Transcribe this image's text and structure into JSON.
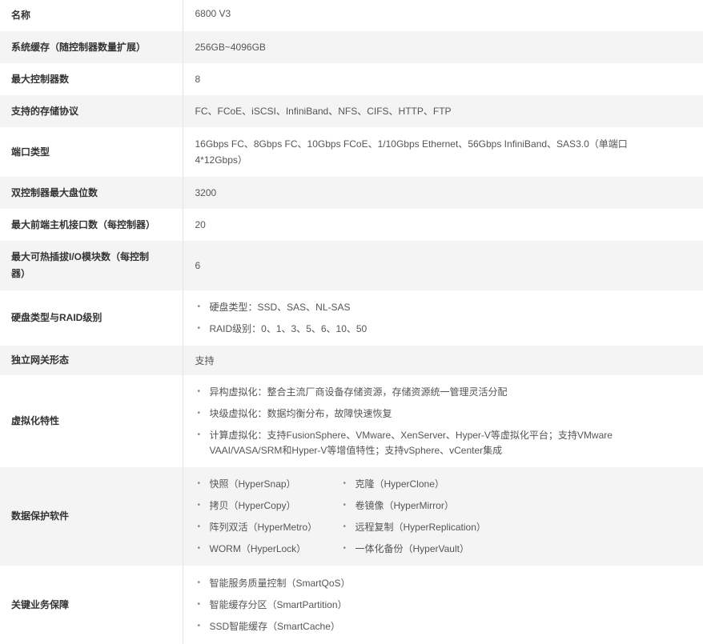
{
  "rows": [
    {
      "label": "名称",
      "value": "6800 V3"
    },
    {
      "label": "系统缓存（随控制器数量扩展）",
      "value": "256GB~4096GB"
    },
    {
      "label": "最大控制器数",
      "value": "8"
    },
    {
      "label": "支持的存储协议",
      "value": "FC、FCoE、iSCSI、InfiniBand、NFS、CIFS、HTTP、FTP"
    },
    {
      "label": "端口类型",
      "value": "16Gbps FC、8Gbps FC、10Gbps FCoE、1/10Gbps Ethernet、56Gbps InfiniBand、SAS3.0（单端口4*12Gbps）"
    },
    {
      "label": "双控制器最大盘位数",
      "value": "3200"
    },
    {
      "label": "最大前端主机接口数（每控制器）",
      "value": "20"
    },
    {
      "label": "最大可热插拔I/O模块数（每控制器）",
      "value": "6"
    },
    {
      "label": "硬盘类型与RAID级别",
      "items": [
        "硬盘类型：SSD、SAS、NL-SAS",
        "RAID级别：0、1、3、5、6、10、50"
      ]
    },
    {
      "label": "独立网关形态",
      "value": "支持"
    },
    {
      "label": "虚拟化特性",
      "items": [
        "异构虚拟化：整合主流厂商设备存储资源，存储资源统一管理灵活分配",
        "块级虚拟化：数据均衡分布，故障快速恢复",
        "计算虚拟化：支持FusionSphere、VMware、XenServer、Hyper-V等虚拟化平台；支持VMware VAAI/VASA/SRM和Hyper-V等增值特性；支持vSphere、vCenter集成"
      ]
    },
    {
      "label": "数据保护软件",
      "left": [
        "快照（HyperSnap）",
        "拷贝（HyperCopy）",
        "阵列双活（HyperMetro）",
        "WORM（HyperLock）"
      ],
      "right": [
        "克隆（HyperClone）",
        "卷镜像（HyperMirror）",
        "远程复制（HyperReplication）",
        "一体化备份（HyperVault）"
      ]
    },
    {
      "label": "关键业务保障",
      "items": [
        "智能服务质量控制（SmartQoS）",
        "智能缓存分区（SmartPartition）",
        "SSD智能缓存（SmartCache）"
      ]
    }
  ]
}
